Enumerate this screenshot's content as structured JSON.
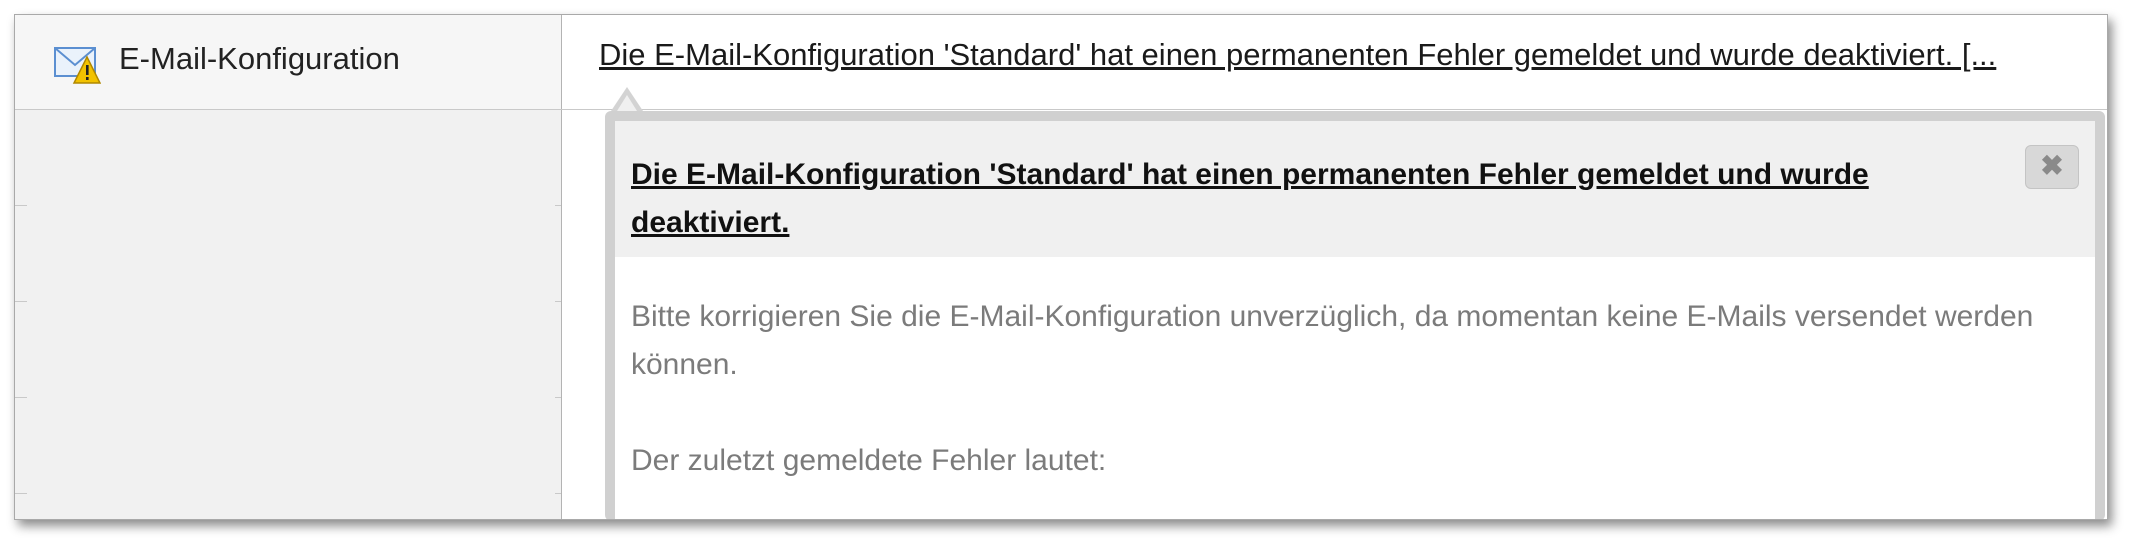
{
  "row": {
    "module_name": "E-Mail-Konfiguration",
    "message_link": "Die E-Mail-Konfiguration 'Standard' hat einen permanenten Fehler gemeldet und wurde deaktiviert. [..."
  },
  "popup": {
    "title": "Die E-Mail-Konfiguration 'Standard' hat einen permanenten Fehler gemeldet und wurde deaktiviert.",
    "close_label": "✖",
    "body_paragraph_1": "Bitte korrigieren Sie die E-Mail-Konfiguration unverzüglich, da momentan keine E-Mails versendet werden können.",
    "body_paragraph_2": "Der zuletzt gemeldete Fehler lautet:"
  },
  "icons": {
    "module_icon": "mail-warning-icon",
    "close_icon": "close-icon"
  },
  "colors": {
    "warning_yellow": "#f2c200",
    "envelope_blue": "#5b8fd1",
    "popup_border": "#d0d0d0",
    "popup_header_bg": "#f0f0f0",
    "body_text": "#7b7b7b"
  }
}
